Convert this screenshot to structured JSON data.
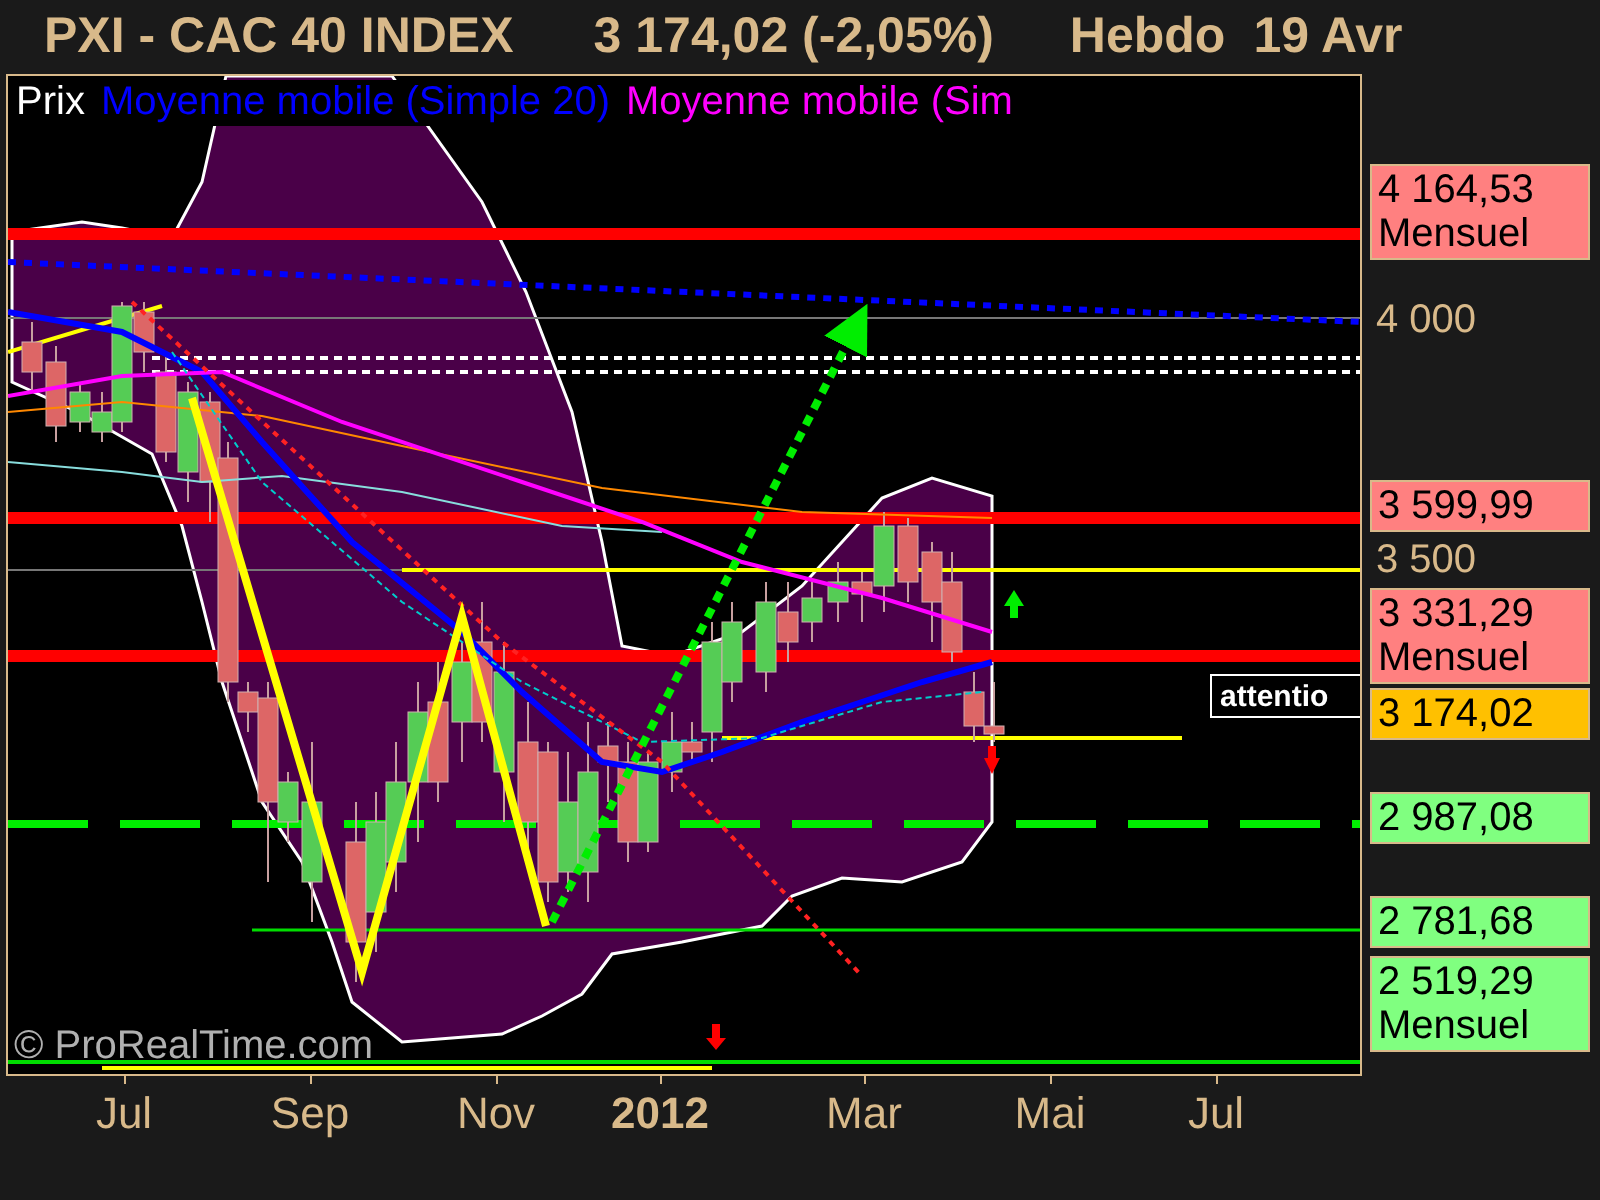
{
  "header": {
    "title": "PXI - CAC 40 INDEX",
    "quote": "3 174,02 (-2,05%)",
    "period": "Hebdo",
    "date": "19 Avr"
  },
  "legend": [
    {
      "label": "Prix",
      "color": "#ffffff"
    },
    {
      "label": "Moyenne mobile (Simple 20)",
      "color": "#0000ff"
    },
    {
      "label": "Moyenne mobile (Sim",
      "color": "#ff00ff"
    }
  ],
  "annotation": {
    "label": "attentio"
  },
  "copyright": "© ProRealTime.com",
  "price_labels": [
    {
      "kind": "resistance",
      "value": "4 164,53",
      "period": "Mensuel"
    },
    {
      "kind": "tick",
      "value": "4 000"
    },
    {
      "kind": "resistance",
      "value": "3 599,99"
    },
    {
      "kind": "tick",
      "value": "3 500"
    },
    {
      "kind": "resistance",
      "value": "3 331,29",
      "period": "Mensuel"
    },
    {
      "kind": "last",
      "value": "3 174,02"
    },
    {
      "kind": "support",
      "value": "2 987,08"
    },
    {
      "kind": "support",
      "value": "2 781,68"
    },
    {
      "kind": "support",
      "value": "2 519,29",
      "period": "Mensuel"
    }
  ],
  "time_labels": [
    {
      "label": "Jul",
      "kind": "month"
    },
    {
      "label": "Sep",
      "kind": "month"
    },
    {
      "label": "Nov",
      "kind": "month"
    },
    {
      "label": "2012",
      "kind": "year"
    },
    {
      "label": "Mar",
      "kind": "month"
    },
    {
      "label": "Mai",
      "kind": "month"
    },
    {
      "label": "Jul",
      "kind": "month"
    }
  ]
}
